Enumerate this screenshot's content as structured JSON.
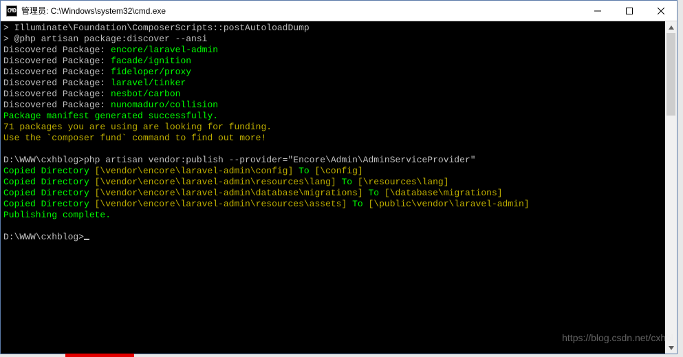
{
  "window": {
    "title": "管理员: C:\\Windows\\system32\\cmd.exe",
    "icon_label": "CMD"
  },
  "terminal": {
    "lines": [
      {
        "parts": [
          {
            "cls": "grey",
            "text": "> Illuminate\\Foundation\\ComposerScripts::postAutoloadDump"
          }
        ]
      },
      {
        "parts": [
          {
            "cls": "grey",
            "text": "> @php artisan package:discover --ansi"
          }
        ]
      },
      {
        "parts": [
          {
            "cls": "grey",
            "text": "Discovered Package: "
          },
          {
            "cls": "green",
            "text": "encore/laravel-admin"
          }
        ]
      },
      {
        "parts": [
          {
            "cls": "grey",
            "text": "Discovered Package: "
          },
          {
            "cls": "green",
            "text": "facade/ignition"
          }
        ]
      },
      {
        "parts": [
          {
            "cls": "grey",
            "text": "Discovered Package: "
          },
          {
            "cls": "green",
            "text": "fideloper/proxy"
          }
        ]
      },
      {
        "parts": [
          {
            "cls": "grey",
            "text": "Discovered Package: "
          },
          {
            "cls": "green",
            "text": "laravel/tinker"
          }
        ]
      },
      {
        "parts": [
          {
            "cls": "grey",
            "text": "Discovered Package: "
          },
          {
            "cls": "green",
            "text": "nesbot/carbon"
          }
        ]
      },
      {
        "parts": [
          {
            "cls": "grey",
            "text": "Discovered Package: "
          },
          {
            "cls": "green",
            "text": "nunomaduro/collision"
          }
        ]
      },
      {
        "parts": [
          {
            "cls": "green",
            "text": "Package manifest generated successfully."
          }
        ]
      },
      {
        "parts": [
          {
            "cls": "yellow",
            "text": "71 packages you are using are looking for funding."
          }
        ]
      },
      {
        "parts": [
          {
            "cls": "yellow",
            "text": "Use the `composer fund` command to find out more!"
          }
        ]
      },
      {
        "parts": [
          {
            "cls": "grey",
            "text": ""
          }
        ]
      },
      {
        "parts": [
          {
            "cls": "grey",
            "text": "D:\\WWW\\cxhblog>php artisan vendor:publish --provider=\"Encore\\Admin\\AdminServiceProvider\""
          }
        ]
      },
      {
        "parts": [
          {
            "cls": "green",
            "text": "Copied Directory "
          },
          {
            "cls": "yellow",
            "text": "[\\vendor\\encore\\laravel-admin\\config]"
          },
          {
            "cls": "green",
            "text": " To "
          },
          {
            "cls": "yellow",
            "text": "[\\config]"
          }
        ]
      },
      {
        "parts": [
          {
            "cls": "green",
            "text": "Copied Directory "
          },
          {
            "cls": "yellow",
            "text": "[\\vendor\\encore\\laravel-admin\\resources\\lang]"
          },
          {
            "cls": "green",
            "text": " To "
          },
          {
            "cls": "yellow",
            "text": "[\\resources\\lang]"
          }
        ]
      },
      {
        "parts": [
          {
            "cls": "green",
            "text": "Copied Directory "
          },
          {
            "cls": "yellow",
            "text": "[\\vendor\\encore\\laravel-admin\\database\\migrations]"
          },
          {
            "cls": "green",
            "text": " To "
          },
          {
            "cls": "yellow",
            "text": "[\\database\\migrations]"
          }
        ]
      },
      {
        "parts": [
          {
            "cls": "green",
            "text": "Copied Directory "
          },
          {
            "cls": "yellow",
            "text": "[\\vendor\\encore\\laravel-admin\\resources\\assets]"
          },
          {
            "cls": "green",
            "text": " To "
          },
          {
            "cls": "yellow",
            "text": "[\\public\\vendor\\laravel-admin]"
          }
        ]
      },
      {
        "parts": [
          {
            "cls": "green",
            "text": "Publishing complete."
          }
        ]
      },
      {
        "parts": [
          {
            "cls": "grey",
            "text": ""
          }
        ]
      },
      {
        "parts": [
          {
            "cls": "grey",
            "text": "D:\\WWW\\cxhblog>"
          }
        ],
        "cursor": true
      }
    ]
  },
  "watermark": "https://blog.csdn.net/cxhbl"
}
